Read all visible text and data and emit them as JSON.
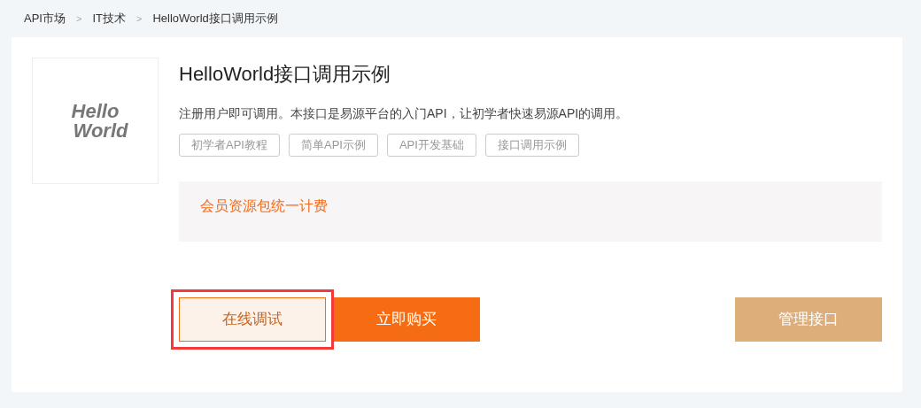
{
  "breadcrumb": [
    {
      "label": "API市场"
    },
    {
      "label": "IT技术"
    },
    {
      "label": "HelloWorld接口调用示例"
    }
  ],
  "breadcrumb_separator": ">",
  "logo": {
    "line_1": "Hello",
    "line_2": "World"
  },
  "title": "HelloWorld接口调用示例",
  "description": "注册用户即可调用。本接口是易源平台的入门API，让初学者快速易源API的调用。",
  "tags": [
    "初学者API教程",
    "简单API示例",
    "API开发基础",
    "接口调用示例"
  ],
  "pricing": "会员资源包统一计费",
  "buttons": [
    {
      "label": "在线调试",
      "kind": "outline",
      "highlighted": true
    },
    {
      "label": "立即购买",
      "kind": "primary",
      "highlighted": false
    },
    {
      "label": "管理接口",
      "kind": "secondary",
      "highlighted": false
    }
  ]
}
